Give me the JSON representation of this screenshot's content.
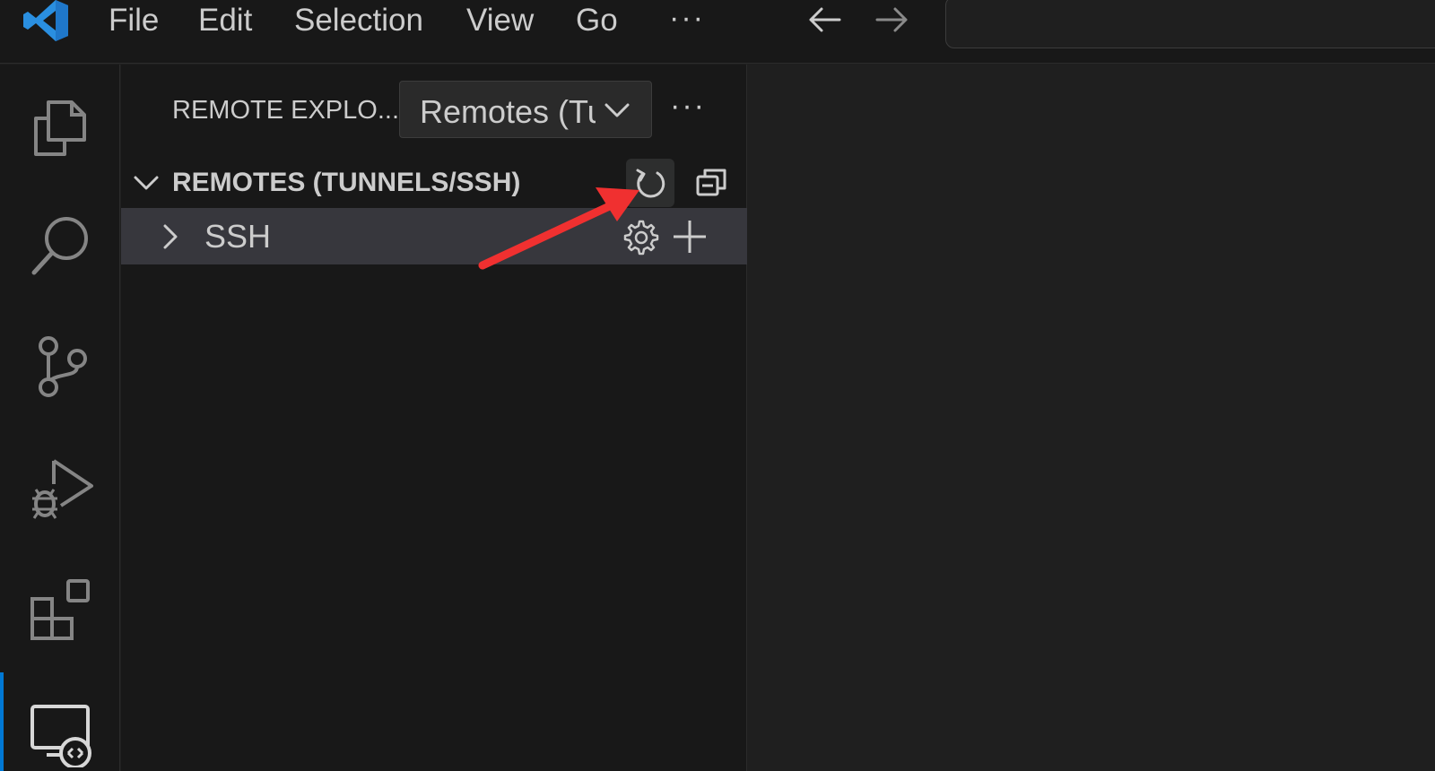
{
  "menubar": {
    "items": [
      "File",
      "Edit",
      "Selection",
      "View",
      "Go"
    ],
    "more": "···",
    "logo_icon": "vscode-logo",
    "back_icon": "arrow-left-icon",
    "forward_icon": "arrow-right-icon"
  },
  "activitybar": {
    "items": [
      {
        "icon": "explorer-files-icon"
      },
      {
        "icon": "search-icon"
      },
      {
        "icon": "source-control-icon"
      },
      {
        "icon": "run-debug-icon"
      },
      {
        "icon": "extensions-icon"
      },
      {
        "icon": "remote-explorer-icon",
        "active": true
      }
    ],
    "active_color": "#0078d4"
  },
  "sidebar": {
    "title": "REMOTE EXPLO...",
    "select_value": "Remotes (Tunnels/SSH)",
    "more": "···",
    "section": {
      "title": "REMOTES (TUNNELS/SSH)",
      "actions": [
        "refresh-icon",
        "collapse-all-icon"
      ]
    },
    "tree": [
      {
        "label": "SSH",
        "actions": [
          "gear-icon",
          "plus-icon"
        ]
      }
    ]
  },
  "annotation": {
    "color": "#f03030",
    "target": "refresh-button"
  }
}
